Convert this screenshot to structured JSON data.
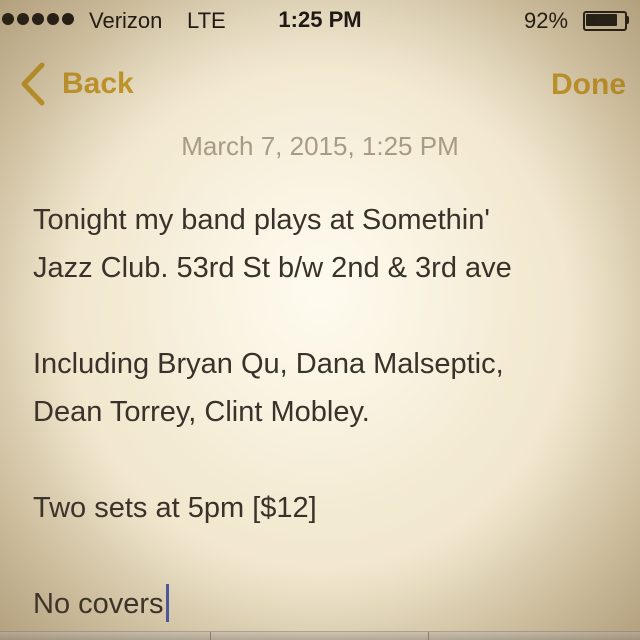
{
  "status_bar": {
    "signal_dots": 5,
    "carrier": "Verizon",
    "network": "LTE",
    "time": "1:25 PM",
    "battery_percent": "92%",
    "battery_level": 0.92
  },
  "nav": {
    "back_label": "Back",
    "done_label": "Done",
    "back_icon": "chevron-left-icon"
  },
  "note": {
    "date": "March 7, 2015, 1:25 PM",
    "lines": [
      "Tonight my band plays at Somethin'",
      "Jazz Club. 53rd St b/w 2nd & 3rd ave",
      "",
      "Including Bryan Qu, Dana Malseptic,",
      "Dean Torrey, Clint Mobley.",
      "",
      "Two sets at 5pm [$12]",
      "",
      "No covers"
    ]
  },
  "colors": {
    "accent": "#c79a2b",
    "text": "#3a322a",
    "date": "#a89b86",
    "cursor": "#4b5aa8",
    "paper": "#f3ecd8"
  }
}
